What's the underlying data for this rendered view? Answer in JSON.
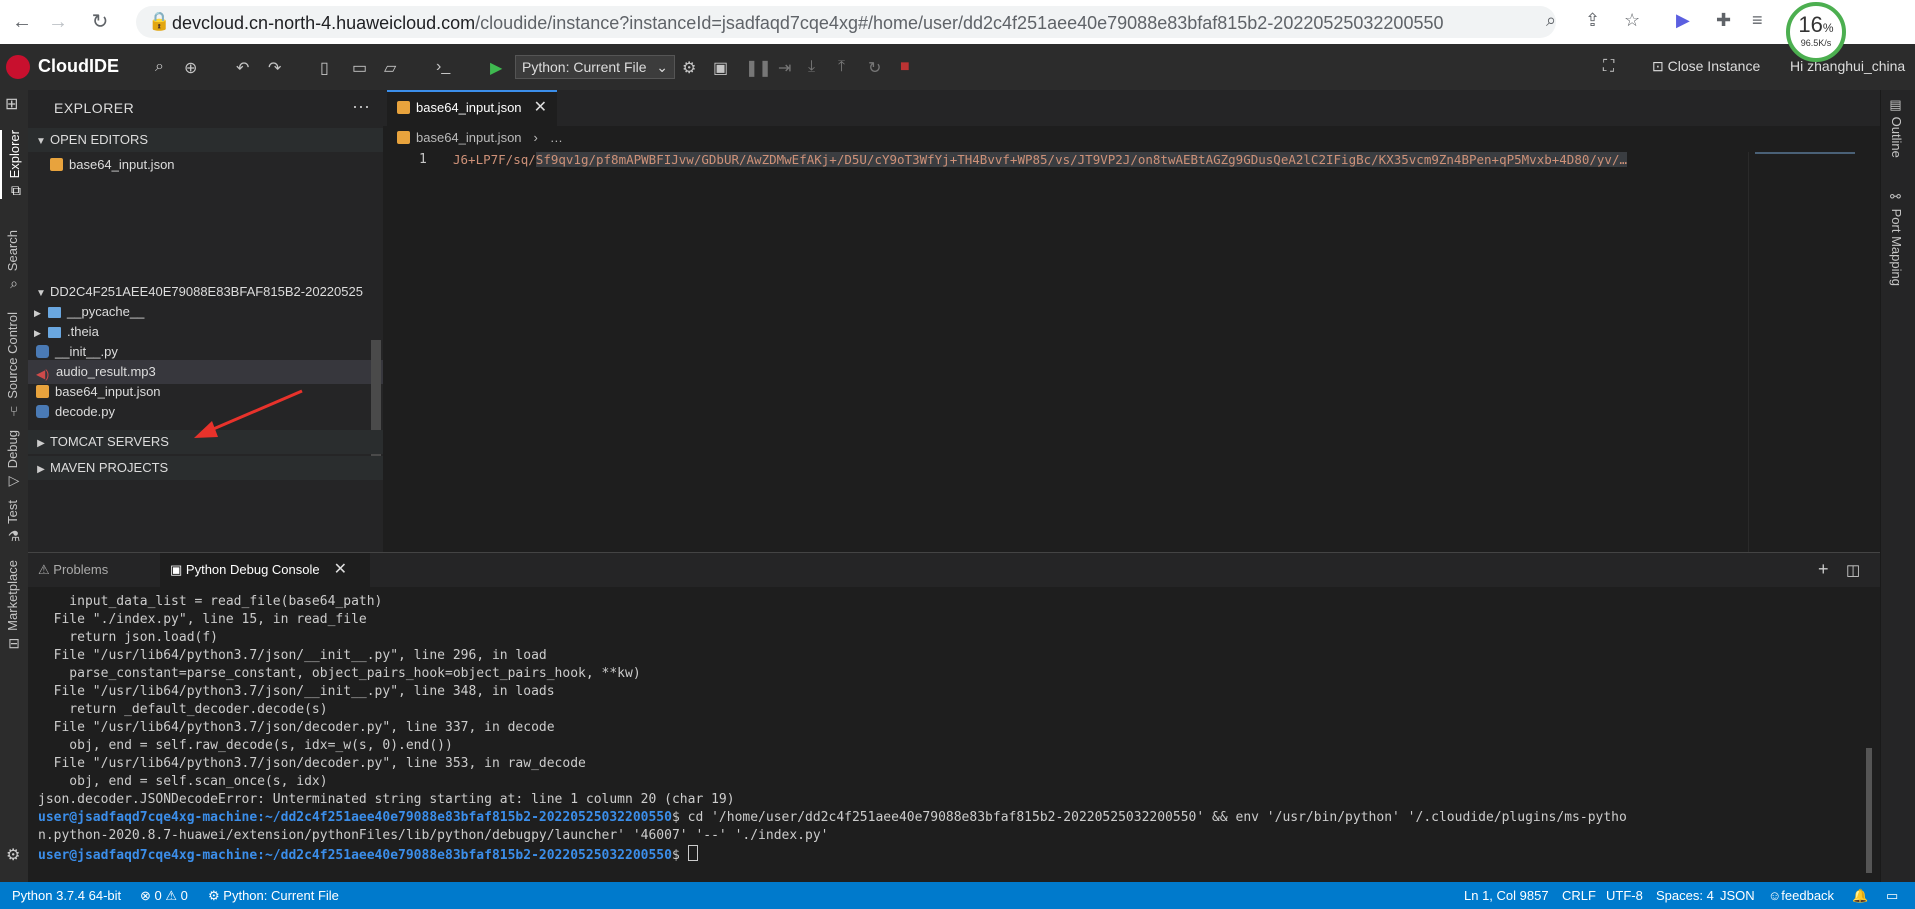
{
  "browser": {
    "url_host": "devcloud.cn-north-4.huaweicloud.com",
    "url_path": "/cloudide/instance?instanceId=jsadfaqd7cqe4xg#/home/user/dd2c4f251aee40e79088e83bfaf815b2-20220525032200550",
    "speed_pct": "16",
    "speed_pct_sign": "%",
    "speed_rate": "96.5K/s"
  },
  "ide": {
    "logo": "CloudIDE",
    "run_config": "Python: Current File",
    "close_instance": "Close Instance",
    "user": "Hi zhanghui_china"
  },
  "activity": {
    "explorer": "Explorer",
    "search": "Search",
    "source_control": "Source Control",
    "debug": "Debug",
    "test": "Test",
    "marketplace": "Marketplace"
  },
  "right_bar": {
    "outline": "Outline",
    "port_mapping": "Port Mapping"
  },
  "sidebar": {
    "title": "EXPLORER",
    "more": "···",
    "open_editors": "OPEN EDITORS",
    "open_file": "base64_input.json",
    "project": "DD2C4F251AEE40E79088E83BFAF815B2-20220525",
    "files": [
      {
        "name": "__pycache__",
        "type": "folder"
      },
      {
        "name": ".theia",
        "type": "folder"
      },
      {
        "name": "__init__.py",
        "type": "py"
      },
      {
        "name": "audio_result.mp3",
        "type": "mp3"
      },
      {
        "name": "base64_input.json",
        "type": "json"
      },
      {
        "name": "decode.py",
        "type": "py"
      }
    ],
    "tomcat": "TOMCAT SERVERS",
    "maven": "MAVEN PROJECTS"
  },
  "editor": {
    "tab": "base64_input.json",
    "breadcrumb_file": "base64_input.json",
    "breadcrumb_more": "…",
    "line_number": "1",
    "code_pre": "J6+LP7F/sq/",
    "code_sel": "Sf9qv1g/pf8mAPWBFIJvw/GDbUR/AwZDMwEfAKj+/D5U/cY9oT3WfYj+TH4Bvvf+WP85/vs/JT9VP2J/on8twAEBtAGZg9GDusQeA2lC2IFigBc/KX35vcm9Zn4BPen+qP5Mvxb+4D80/yv/…"
  },
  "panel": {
    "problems": "Problems",
    "console": "Python Debug Console",
    "lines": [
      "    input_data_list = read_file(base64_path)",
      "  File \"./index.py\", line 15, in read_file",
      "    return json.load(f)",
      "  File \"/usr/lib64/python3.7/json/__init__.py\", line 296, in load",
      "    parse_constant=parse_constant, object_pairs_hook=object_pairs_hook, **kw)",
      "  File \"/usr/lib64/python3.7/json/__init__.py\", line 348, in loads",
      "    return _default_decoder.decode(s)",
      "  File \"/usr/lib64/python3.7/json/decoder.py\", line 337, in decode",
      "    obj, end = self.raw_decode(s, idx=_w(s, 0).end())",
      "  File \"/usr/lib64/python3.7/json/decoder.py\", line 353, in raw_decode",
      "    obj, end = self.scan_once(s, idx)",
      "json.decoder.JSONDecodeError: Unterminated string starting at: line 1 column 20 (char 19)"
    ],
    "prompt": "user@jsadfaqd7cqe4xg-machine:~/dd2c4f251aee40e79088e83bfaf815b2-20220525032200550",
    "cmd": "$ cd '/home/user/dd2c4f251aee40e79088e83bfaf815b2-20220525032200550' && env '/usr/bin/python' '/.cloudide/plugins/ms-pytho",
    "cmd2": "n.python-2020.8.7-huawei/extension/pythonFiles/lib/python/debugpy/launcher' '46007' '--' './index.py'",
    "dollar": "$ "
  },
  "status": {
    "python": "Python 3.7.4 64-bit",
    "problems": "⊗ 0 ⚠ 0",
    "run_config": "Python: Current File",
    "position": "Ln 1, Col 9857",
    "eol": "CRLF",
    "encoding": "UTF-8",
    "spaces": "Spaces: 4",
    "language": "JSON",
    "feedback": "feedback"
  },
  "colors": {
    "accent": "#007acc",
    "tab_border": "#3b8eea",
    "prompt": "#3b8eea",
    "string": "#ce9178",
    "arrow": "#e8322b"
  }
}
